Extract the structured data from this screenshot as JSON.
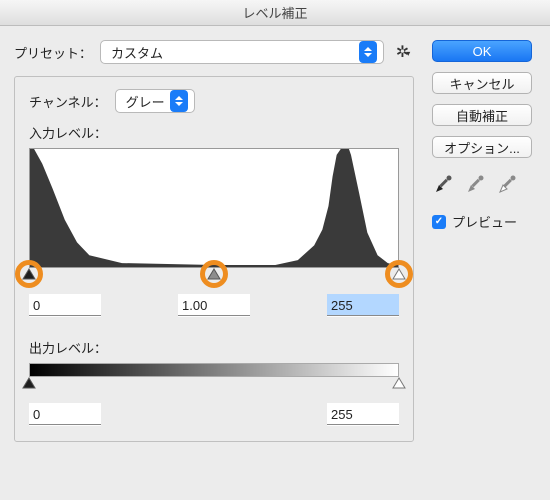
{
  "title": "レベル補正",
  "preset": {
    "label": "プリセット：",
    "value": "カスタム"
  },
  "channel": {
    "label": "チャンネル：",
    "value": "グレー"
  },
  "input": {
    "label": "入力レベル：",
    "black": "0",
    "gamma": "1.00",
    "white": "255",
    "slider_positions": {
      "black_pct": 0,
      "gamma_pct": 50,
      "white_pct": 100
    }
  },
  "output": {
    "label": "出力レベル：",
    "black": "0",
    "white": "255",
    "slider_positions": {
      "black_pct": 0,
      "white_pct": 100
    }
  },
  "buttons": {
    "ok": "OK",
    "cancel": "キャンセル",
    "auto": "自動補正",
    "options": "オプション..."
  },
  "preview": {
    "label": "プレビュー",
    "checked": true
  },
  "eyedroppers": {
    "black": "black-point",
    "gray": "gray-point",
    "white": "white-point"
  },
  "annotations": {
    "highlight_sliders": true
  }
}
